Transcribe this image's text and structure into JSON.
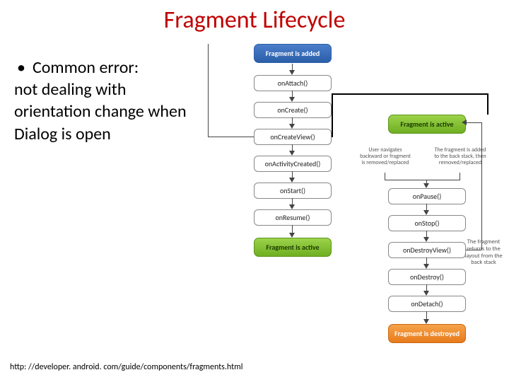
{
  "title": "Fragment Lifecycle",
  "bullet": {
    "lead": "Common error:",
    "rest": "not dealing with orientation change when Dialog is open"
  },
  "footnote": "http: //developer. android. com/guide/components/fragments.html",
  "diagram": {
    "left": {
      "start": "Fragment is added",
      "steps": [
        "onAttach()",
        "onCreate()",
        "onCreateView()",
        "onActivityCreated()",
        "onStart()",
        "onResume()"
      ],
      "end": "Fragment is active"
    },
    "right": {
      "start": "Fragment is active",
      "steps": [
        "onPause()",
        "onStop()",
        "onDestroyView()",
        "onDestroy()",
        "onDetach()"
      ],
      "end": "Fragment is destroyed"
    },
    "notes": {
      "left_mid": "User navigates backward or fragment is removed/replaced",
      "right_mid": "The fragment is added to the back stack, then removed/replaced",
      "return_note": "The fragment returns to the layout from the back stack"
    }
  }
}
